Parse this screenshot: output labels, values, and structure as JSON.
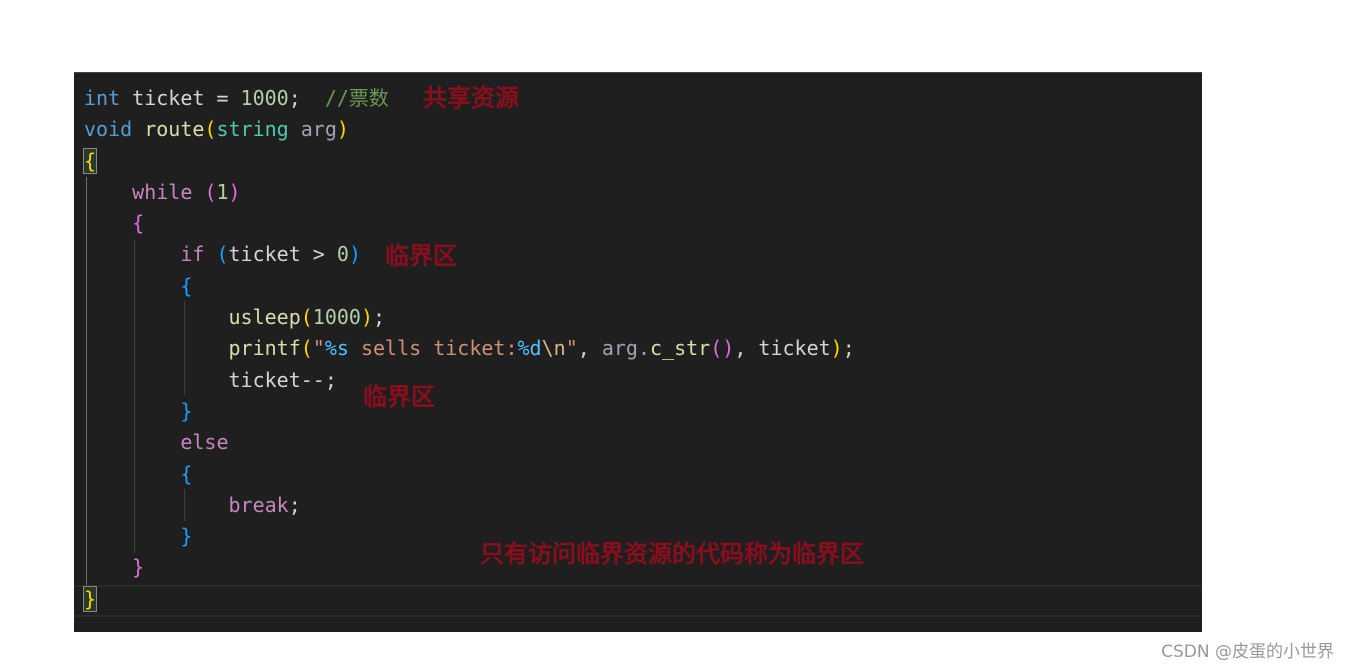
{
  "code": {
    "line1": {
      "kw": "int",
      "name": " ticket = ",
      "num": "1000",
      "semi": ";  ",
      "comment": "//票数"
    },
    "line2": {
      "kw": "void",
      "fn": " route",
      "open": "(",
      "type": "string",
      "param": " arg",
      "close": ")"
    },
    "line3": {
      "brace": "{"
    },
    "line4": {
      "kw": "while",
      "space": " ",
      "open": "(",
      "num": "1",
      "close": ")"
    },
    "line5": {
      "brace": "{"
    },
    "line6": {
      "kw": "if",
      "space": " ",
      "open": "(",
      "expr": "ticket > ",
      "num": "0",
      "close": ")"
    },
    "line7": {
      "brace": "{"
    },
    "line8": {
      "fn": "usleep",
      "open": "(",
      "num": "1000",
      "close": ")",
      "semi": ";"
    },
    "line9": {
      "fn": "printf",
      "open": "(",
      "q1": "\"",
      "fmt1": "%s",
      "str1": " sells ticket:",
      "fmt2": "%d",
      "esc": "\\n",
      "q2": "\"",
      "comma": ", ",
      "arg": "arg.",
      "method": "c_str",
      "mopen": "(",
      "mclose": ")",
      "comma2": ", ",
      "var": "ticket",
      "close": ")",
      "semi": ";"
    },
    "line10": {
      "text": "ticket--;"
    },
    "line11": {
      "brace": "}"
    },
    "line12": {
      "kw": "else"
    },
    "line13": {
      "brace": "{"
    },
    "line14": {
      "kw": "break",
      "semi": ";"
    },
    "line15": {
      "brace": "}"
    },
    "line16": {
      "brace": "}"
    },
    "line17": {
      "brace": "}"
    }
  },
  "annotations": {
    "shared_resource": "共享资源",
    "critical_section_1": "临界区",
    "critical_section_2": "临界区",
    "explanation": "只有访问临界资源的代码称为临界区"
  },
  "watermark": "CSDN @皮蛋的小世界"
}
